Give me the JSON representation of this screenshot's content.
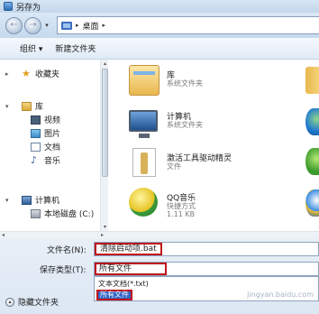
{
  "window": {
    "title": "另存为"
  },
  "nav": {
    "back": "←",
    "forward": "→",
    "dropdown": "▾",
    "path": "桌面",
    "path_arrow": "▸"
  },
  "toolbar": {
    "organize": "组织 ▾",
    "new_folder": "新建文件夹"
  },
  "sidebar": {
    "favorites": "收藏夹",
    "libraries": "库",
    "library_items": [
      "视频",
      "图片",
      "文档",
      "音乐"
    ],
    "computer": "计算机",
    "drive": "本地磁盘 (C:)"
  },
  "files": [
    {
      "name": "库",
      "sub": "系统文件夹",
      "icon": "library-icon"
    },
    {
      "name": "计算机",
      "sub": "系统文件夹",
      "icon": "computer-icon"
    },
    {
      "name": "激活工具驱动精灵",
      "sub": "文件",
      "icon": "file-icon"
    },
    {
      "name": "QQ音乐",
      "sub": "快捷方式",
      "sub2": "1.11 KB",
      "icon": "qqmusic-icon"
    }
  ],
  "save": {
    "filename_label": "文件名(N):",
    "filename_value": "清除启动项.bat",
    "type_label": "保存类型(T):",
    "type_value": "所有文件",
    "type_options": [
      "文本文档(*.txt)",
      "所有文件"
    ]
  },
  "footer": {
    "hide_folders": "隐藏文件夹",
    "watermark": "jingyan.baidu.com"
  }
}
